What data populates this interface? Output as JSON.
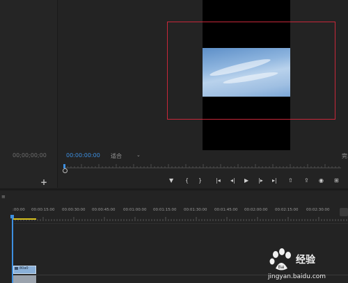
{
  "source_panel": {
    "timecode": "00;00;00;00",
    "add_symbol": "+"
  },
  "program_monitor": {
    "timecode": "00:00:00:00",
    "fit_label": "适合",
    "complete_label": "完"
  },
  "transport_controls": [
    {
      "icon": "marker-icon",
      "glyph": "▼"
    },
    {
      "icon": "mark-in-icon",
      "glyph": "{"
    },
    {
      "icon": "mark-out-icon",
      "glyph": "}"
    },
    {
      "icon": "go-to-in-icon",
      "glyph": "|◂"
    },
    {
      "icon": "step-back-icon",
      "glyph": "◂|"
    },
    {
      "icon": "play-icon",
      "glyph": "▶"
    },
    {
      "icon": "step-forward-icon",
      "glyph": "|▸"
    },
    {
      "icon": "go-to-out-icon",
      "glyph": "▸|"
    },
    {
      "icon": "lift-icon",
      "glyph": "⇧"
    },
    {
      "icon": "extract-icon",
      "glyph": "⇪"
    },
    {
      "icon": "export-frame-icon",
      "glyph": "◉"
    },
    {
      "icon": "button-editor-icon",
      "glyph": "⊞"
    }
  ],
  "timeline": {
    "menu_icon": "≡",
    "ruler_labels": [
      ":00:00",
      "00:00:15:00",
      "00:00:30:00",
      "00:00:45:00",
      "00:01:00:00",
      "00:01:15:00",
      "00:01:30:00",
      "00:01:45:00",
      "00:02:00:00",
      "00:02:15:00",
      "00:02:30:00"
    ],
    "clip_label": "80a0"
  },
  "watermark": {
    "brand": "Bai",
    "text": "经验",
    "url": "jingyan.baidu.com"
  },
  "colors": {
    "accent": "#3d8fe0",
    "highlight_box": "#c8283a",
    "work_area": "#d9c21e"
  }
}
